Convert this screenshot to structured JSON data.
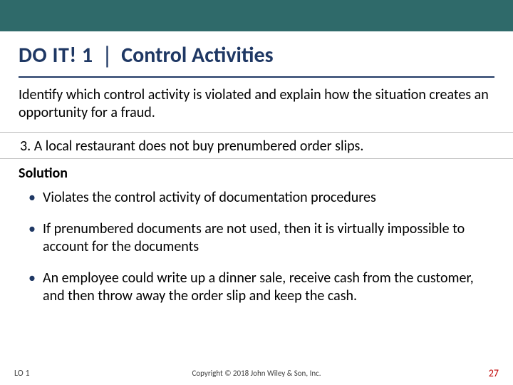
{
  "title": {
    "prefix": "DO IT! 1",
    "main": "Control Activities"
  },
  "prompt": "Identify which control activity is violated and explain how the situation creates an opportunity for a fraud.",
  "question": "3.   A local restaurant does not buy prenumbered order slips.",
  "solution_label": "Solution",
  "bullets": [
    "Violates the control activity of documentation procedures",
    "If prenumbered documents are not used, then it is virtually impossible to account for the documents",
    "An employee could write up a dinner sale, receive cash from the customer, and then throw away the order slip and keep the cash."
  ],
  "footer": {
    "lo": "LO 1",
    "copyright": "Copyright © 2018 John Wiley & Son, Inc.",
    "page": "27"
  }
}
